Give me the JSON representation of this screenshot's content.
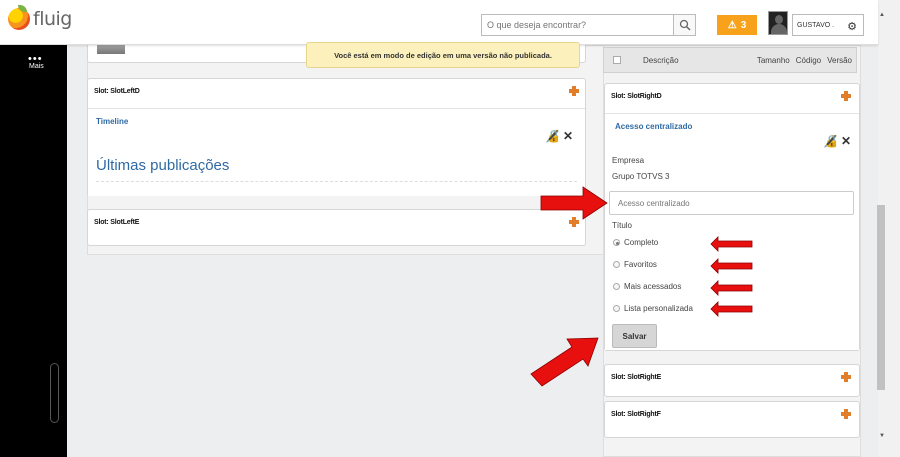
{
  "app": {
    "logo_text": "fluig"
  },
  "header": {
    "search_placeholder": "O que deseja encontrar?",
    "alert_count": "3",
    "user_name": "GUSTAVO .",
    "search_icon": "magnifier-icon",
    "alert_icon": "warning-triangle-icon",
    "gear_icon": "gear-icon"
  },
  "sidebar": {
    "more_label": "Mais"
  },
  "banner": {
    "text": "Você está em modo de edição em uma versão não publicada."
  },
  "table": {
    "columns": [
      "Descrição",
      "Tamanho",
      "Código",
      "Versão"
    ]
  },
  "left": {
    "slot_d": "Slot: SlotLeftD",
    "timeline_title": "Timeline",
    "publications_heading": "Últimas publicações",
    "slot_e": "Slot: SlotLeftE"
  },
  "right": {
    "slot_d": "Slot: SlotRightD",
    "widget_title": "Acesso centralizado",
    "company_label": "Empresa",
    "company_value": "Grupo TOTVS 3",
    "title_input_placeholder": "Acesso centralizado",
    "titulo_label": "Título",
    "options": [
      "Completo",
      "Favoritos",
      "Mais acessados",
      "Lista personalizada"
    ],
    "selected_option": "Completo",
    "save_label": "Salvar",
    "slot_e": "Slot: SlotRightE",
    "slot_f": "Slot: SlotRightF"
  },
  "colors": {
    "accent": "#2f6aa3",
    "alert": "#f7a21a",
    "banner": "#fcf1bd",
    "arrow": "#e8100f"
  }
}
